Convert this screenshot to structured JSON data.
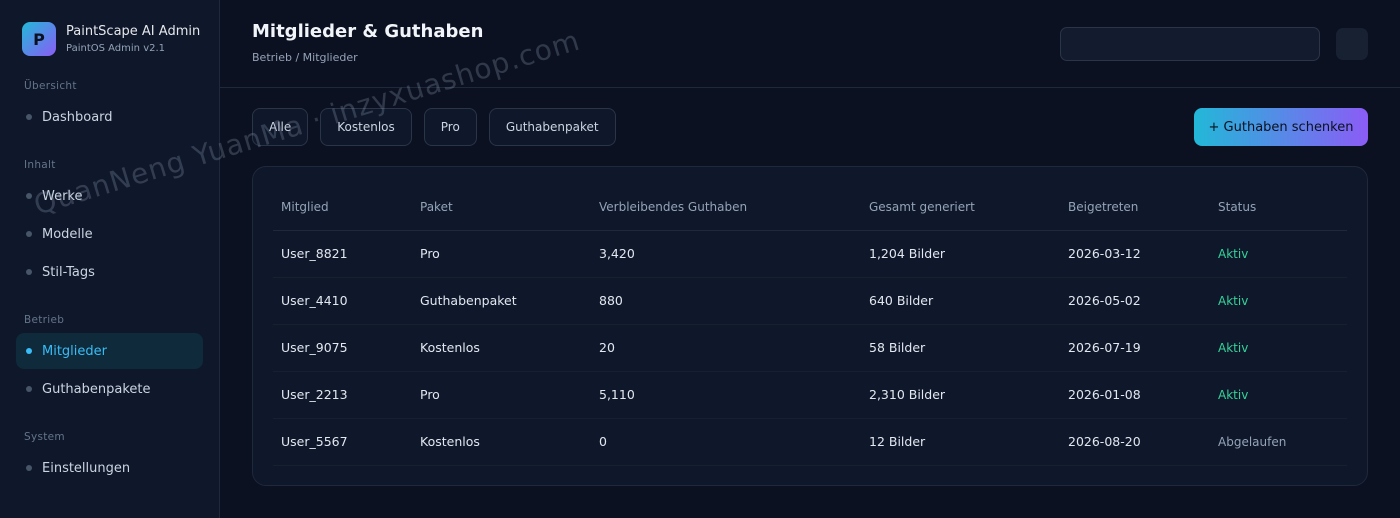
{
  "brand": {
    "logo_letter": "P",
    "title": "PaintScape AI Admin",
    "subtitle": "PaintOS Admin v2.1"
  },
  "sidebar": {
    "sections": [
      {
        "label": "Übersicht",
        "items": [
          {
            "label": "Dashboard"
          }
        ]
      },
      {
        "label": "Inhalt",
        "items": [
          {
            "label": "Werke"
          },
          {
            "label": "Modelle"
          },
          {
            "label": "Stil-Tags"
          }
        ]
      },
      {
        "label": "Betrieb",
        "items": [
          {
            "label": "Mitglieder",
            "active": true
          },
          {
            "label": "Guthabenpakete"
          }
        ]
      },
      {
        "label": "System",
        "items": [
          {
            "label": "Einstellungen"
          }
        ]
      }
    ]
  },
  "header": {
    "title": "Mitglieder & Guthaben",
    "breadcrumb": "Betrieb / Mitglieder",
    "search_value": ""
  },
  "filters": [
    "Alle",
    "Kostenlos",
    "Pro",
    "Guthabenpaket"
  ],
  "actions": {
    "gift_credits": "+ Guthaben schenken"
  },
  "table": {
    "columns": [
      "Mitglied",
      "Paket",
      "Verbleibendes Guthaben",
      "Gesamt generiert",
      "Beigetreten",
      "Status"
    ],
    "rows": [
      {
        "member": "User_8821",
        "plan": "Pro",
        "credits": "3,420",
        "generated": "1,204 Bilder",
        "joined": "2026-03-12",
        "status": "Aktiv"
      },
      {
        "member": "User_4410",
        "plan": "Guthabenpaket",
        "credits": "880",
        "generated": "640 Bilder",
        "joined": "2026-05-02",
        "status": "Aktiv"
      },
      {
        "member": "User_9075",
        "plan": "Kostenlos",
        "credits": "20",
        "generated": "58 Bilder",
        "joined": "2026-07-19",
        "status": "Aktiv"
      },
      {
        "member": "User_2213",
        "plan": "Pro",
        "credits": "5,110",
        "generated": "2,310 Bilder",
        "joined": "2026-01-08",
        "status": "Aktiv"
      },
      {
        "member": "User_5567",
        "plan": "Kostenlos",
        "credits": "0",
        "generated": "12 Bilder",
        "joined": "2026-08-20",
        "status": "Abgelaufen"
      }
    ]
  },
  "watermark": "QuanNeng YuanMa · inzyxuashop.com",
  "colors": {
    "accent": "#38bdf8",
    "active_status": "#34d399",
    "expired_status": "#94a3b8"
  }
}
